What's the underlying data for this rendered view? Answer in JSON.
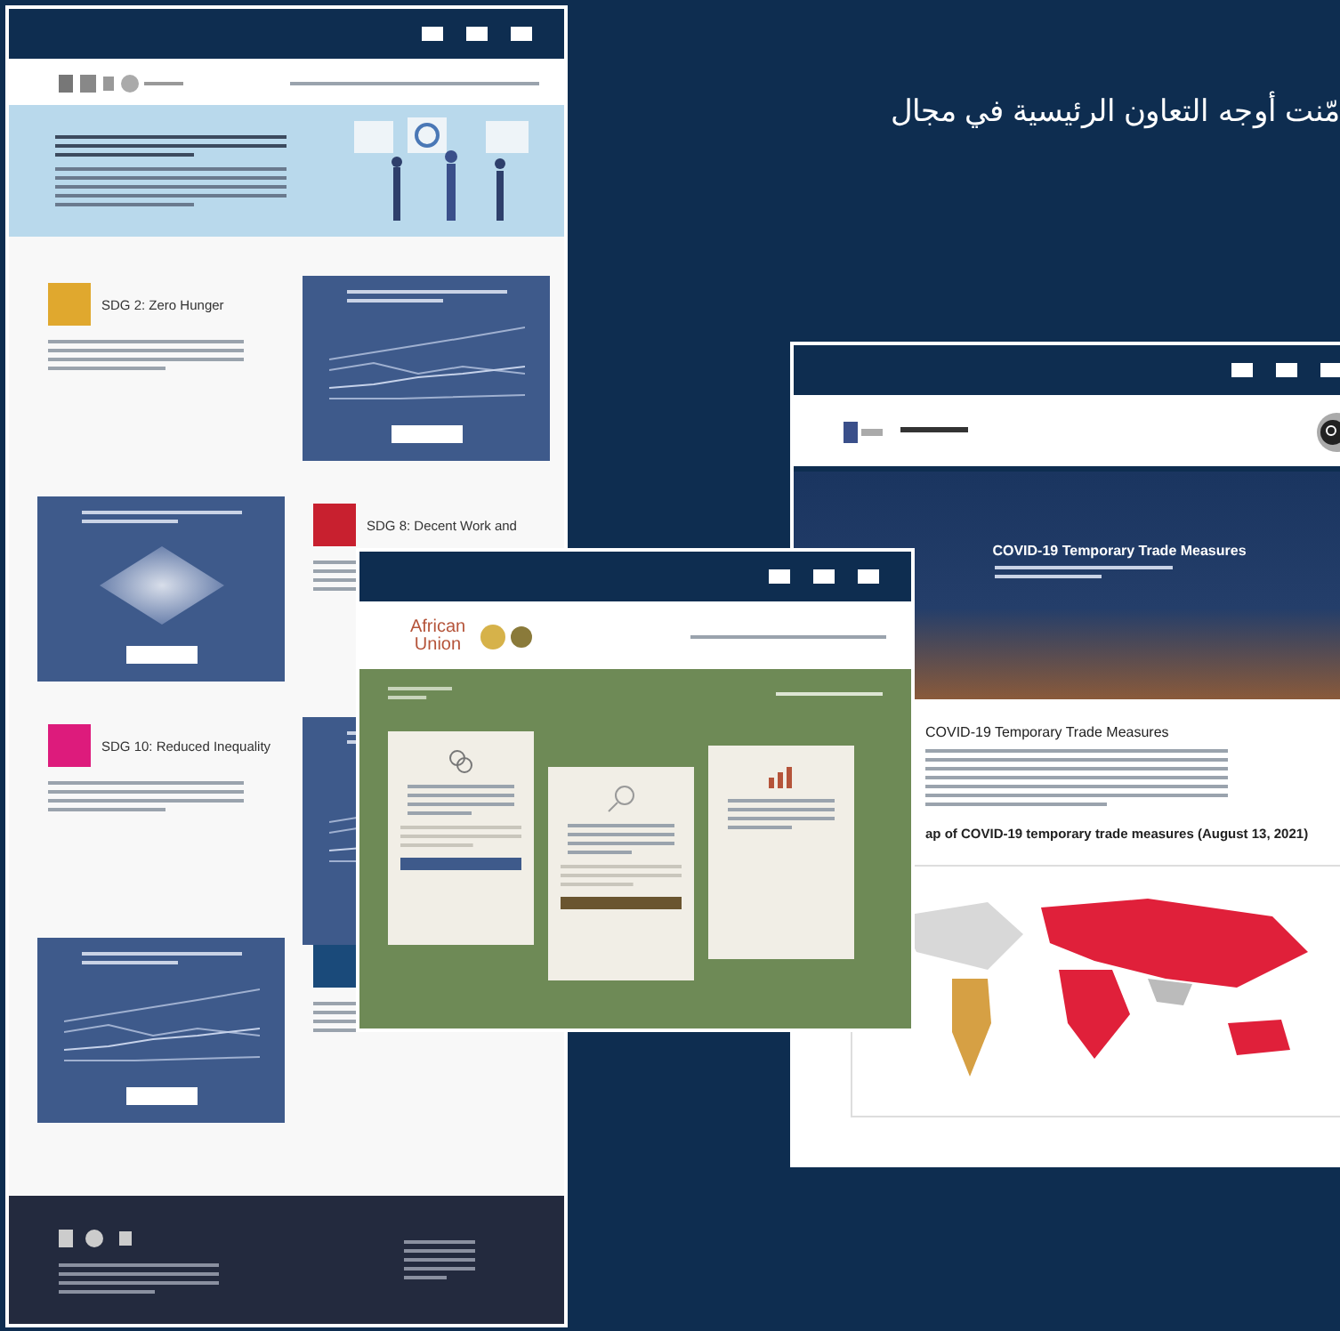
{
  "caption": "مّنت أوجه التعاون الرئيسية في مجال",
  "windows": [
    {
      "kind": "sdg",
      "sections": [
        {
          "title": "SDG 2: Zero Hunger",
          "color": "#e0a82e"
        },
        {
          "title": "SDG 8: Decent Work and",
          "color": "#c8202f"
        },
        {
          "title": "SDG 10: Reduced Inequality",
          "color": "#dd1b7c"
        }
      ]
    },
    {
      "kind": "covid",
      "banner_title": "COVID-19 Temporary Trade Measures",
      "heading": "COVID-19 Temporary Trade Measures",
      "map_title": "ap of COVID-19 temporary trade measures (August 13, 2021)"
    },
    {
      "kind": "au",
      "logo": "African Union"
    }
  ]
}
